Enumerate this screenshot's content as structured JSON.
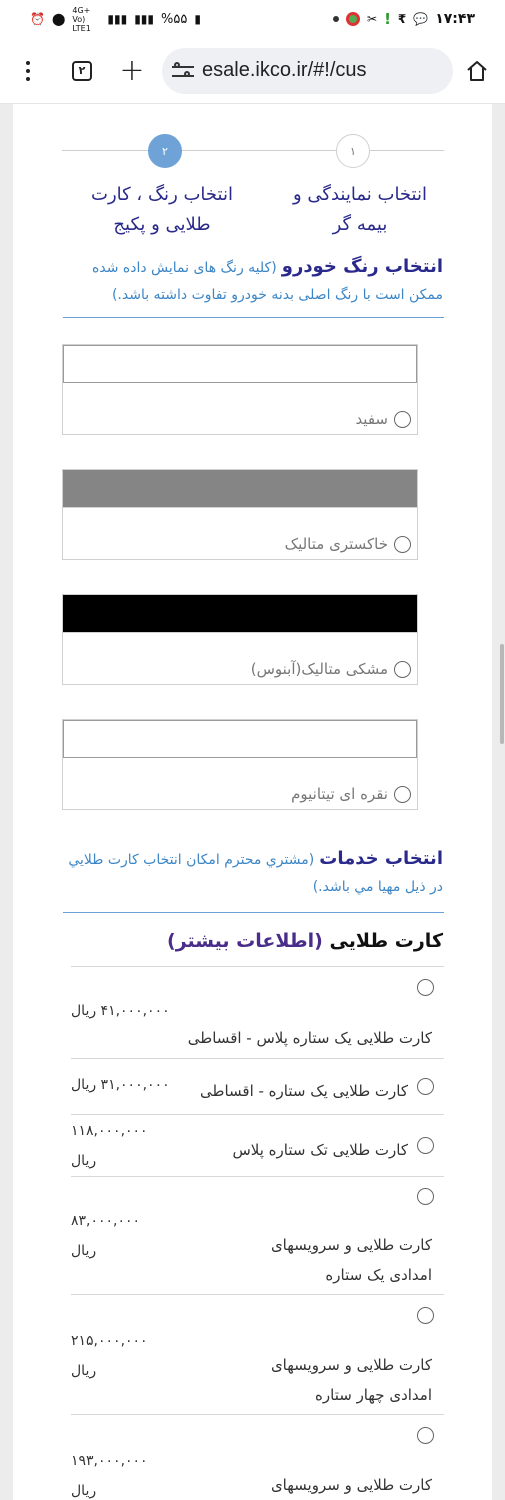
{
  "status_bar": {
    "time": "۱۷:۴۳",
    "battery": "%۵۵",
    "network": "4G+ Vo) LTE1"
  },
  "browser": {
    "tabs_count": "۲",
    "url": "esale.ikco.ir/#!/cus"
  },
  "stepper": {
    "steps": [
      {
        "number": "۱",
        "label": "انتخاب نمایندگی و بیمه گر"
      },
      {
        "number": "۲",
        "label": "انتخاب رنگ ، کارت طلایی و پکیج"
      }
    ]
  },
  "color_section": {
    "title": "انتخاب رنگ خودرو",
    "note": "(کلیه رنگ های نمایش داده شده ممکن است با رنگ اصلی بدنه خودرو تفاوت داشته باشد.)",
    "options": [
      {
        "name": "سفید",
        "swatch": "#ffffff"
      },
      {
        "name": "خاکستری متالیک",
        "swatch": "#858585"
      },
      {
        "name": "مشکی متالیک(آبنوس)",
        "swatch": "#000000"
      },
      {
        "name": "نقره ای تیتانیوم",
        "swatch": "#ffffff"
      }
    ]
  },
  "services_section": {
    "title": "انتخاب خدمات",
    "note": "(مشتري محترم امکان انتخاب کارت طلايي در ذيل مهيا مي باشد.)"
  },
  "gold_card": {
    "title": "کارت طلایی",
    "more_info": "(اطلاعات بیشتر)",
    "items": [
      {
        "name": "کارت طلایی یک ستاره پلاس - اقساطی",
        "price": "۴۱,۰۰۰,۰۰۰ ریال"
      },
      {
        "name": "کارت طلایی یک ستاره - اقساطی",
        "price": "۳۱,۰۰۰,۰۰۰ ریال"
      },
      {
        "name": "کارت طلایی تک ستاره پلاس",
        "price": "۱۱۸,۰۰۰,۰۰۰ ریال"
      },
      {
        "name": "کارت طلایی و سرویسهای امدادی یک ستاره",
        "price": "۸۳,۰۰۰,۰۰۰ ریال"
      },
      {
        "name": "کارت طلایی و سرویسهای امدادی چهار ستاره",
        "price": "۲۱۵,۰۰۰,۰۰۰ ریال"
      },
      {
        "name": "کارت طلایی و سرویسهای امدادی سه",
        "price": "۱۹۳,۰۰۰,۰۰۰ ریال"
      }
    ]
  }
}
